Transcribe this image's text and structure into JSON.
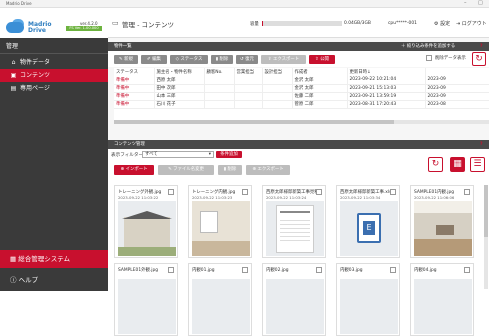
{
  "window": {
    "title": "Madrio Drive",
    "controls": [
      "–",
      "□"
    ]
  },
  "logo": {
    "name_line1": "Madrio",
    "name_line2": "Drive",
    "version": "ver.4.2.0",
    "version_badge": "FS Ver. 1.00.000"
  },
  "header": {
    "breadcrumb": "管理 - コンテンツ",
    "capacity_label": "容量",
    "capacity_value": "0.04GB/3GB",
    "capacity_fraction": 0.013,
    "cpu": "cpu*****-001",
    "settings": "設定",
    "logout": "ログアウト"
  },
  "sidebar": {
    "header": "管理",
    "items": [
      {
        "label": "物件データ",
        "icon": "house-icon"
      },
      {
        "label": "コンテンツ",
        "icon": "image-icon"
      },
      {
        "label": "専用ページ",
        "icon": "page-icon"
      }
    ],
    "system_button": "総合管理システム",
    "help": "ヘルプ"
  },
  "property_panel": {
    "title": "物件一覧",
    "add_filter": "絞り込み条件を追加する",
    "toolbar": [
      "新規",
      "編集",
      "ステータス",
      "削除",
      "復元",
      "エクスポート",
      "公開"
    ],
    "show_deleted": "削除データ表示",
    "columns": [
      "ステータス",
      "施主名・物件名称",
      "顧客No.",
      "営業担当",
      "設計担当",
      "作成者",
      "更新日時↓"
    ],
    "rows": [
      {
        "status": "準備中",
        "owner": "西原 太郎",
        "no": "",
        "sales": "",
        "design": "",
        "creator": "金沢 太郎",
        "updated": "2023-09-22 10:21:04",
        "extra": "2023-09"
      },
      {
        "status": "準備中",
        "owner": "田中 次郎",
        "no": "",
        "sales": "",
        "design": "",
        "creator": "金沢 太郎",
        "updated": "2023-09-21 15:13:03",
        "extra": "2023-09"
      },
      {
        "status": "準備中",
        "owner": "山本 三郎",
        "no": "",
        "sales": "",
        "design": "",
        "creator": "佐藤 二郎",
        "updated": "2023-09-21 13:59:19",
        "extra": "2023-09"
      },
      {
        "status": "準備中",
        "owner": "石川 花子",
        "no": "",
        "sales": "",
        "design": "",
        "creator": "菅原 二郎",
        "updated": "2023-08-31 17:20:43",
        "extra": "2023-08"
      }
    ]
  },
  "content_panel": {
    "title": "コンテンツ管理",
    "filter_label": "表示フィルター",
    "filter_value": "すべて",
    "filter_add": "条件追加",
    "toolbar": [
      "インポート",
      "ファイル名変更",
      "削除",
      "エクスポート"
    ],
    "cards": [
      {
        "name": "トレーニング外観.jpg",
        "date": "2023-09-22 11:03:22",
        "thumb": "house"
      },
      {
        "name": "トレーニング内観.jpg",
        "date": "2023-09-22 11:03:23",
        "thumb": "room"
      },
      {
        "name": "西原太郎様邸新築工事見積.pdf",
        "date": "2023-09-22 11:03:24",
        "thumb": "doc"
      },
      {
        "name": "西原太郎様邸新築工事.xls",
        "date": "2023-09-22 11:03:34",
        "thumb": "xls"
      },
      {
        "name": "SAMPLE01内観.jpg",
        "date": "2023-09-22 11:06:06",
        "thumb": "room2"
      },
      {
        "name": "SAMPLE01外観.jpg",
        "date": "",
        "thumb": "blank"
      },
      {
        "name": "内観01.jpg",
        "date": "",
        "thumb": "blank"
      },
      {
        "name": "内観02.jpg",
        "date": "",
        "thumb": "blank"
      },
      {
        "name": "内観03.jpg",
        "date": "",
        "thumb": "blank"
      },
      {
        "name": "内観04.jpg",
        "date": "",
        "thumb": "blank"
      }
    ]
  }
}
